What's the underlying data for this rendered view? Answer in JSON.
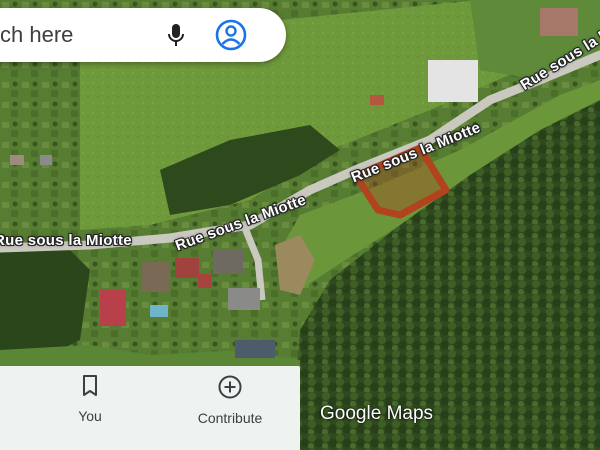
{
  "search": {
    "text": "ch here"
  },
  "roads": [
    {
      "name": "Rue sous la Miotte"
    },
    {
      "name": "Rue sous la Miotte"
    },
    {
      "name": "Rue sous la Miotte"
    },
    {
      "name": "Rue sous la Miotte"
    },
    {
      "name": "Rue sous la Miotte"
    }
  ],
  "bottom_nav": {
    "you_label": "You",
    "contribute_label": "Contribute"
  },
  "watermark": {
    "brand": "Google",
    "product": "Maps"
  },
  "colors": {
    "parcel_outline": "#b2431f",
    "search_icon_accent": "#1a73e8"
  },
  "icons": [
    "mic-icon",
    "account-icon",
    "bookmark-icon",
    "add-circle-icon"
  ]
}
